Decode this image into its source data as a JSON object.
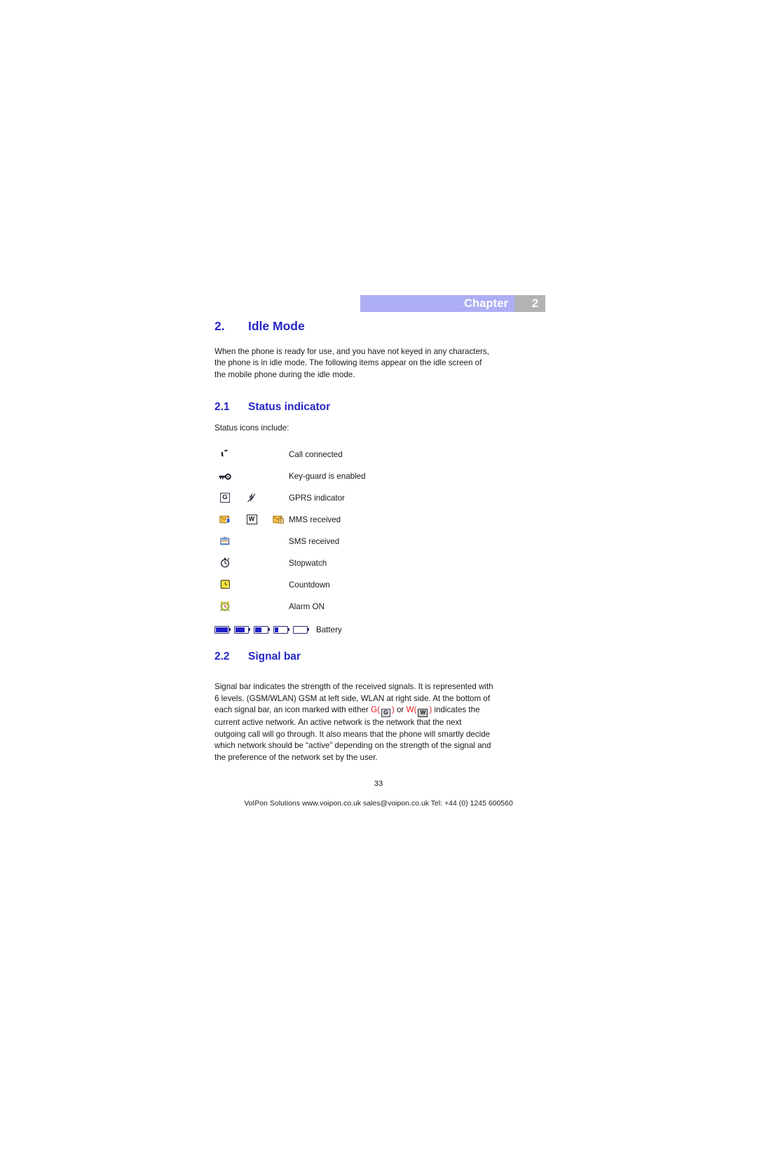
{
  "header": {
    "chapter_label": "Chapter",
    "chapter_number": "2",
    "bar_color": "#aeaef5",
    "number_block_color": "#b3b3b3"
  },
  "section": {
    "number": "2.",
    "title": "Idle Mode",
    "heading_color": "#2626c8",
    "intro": "When the phone is ready for use, and you have not keyed in any characters, the phone is in idle mode. The following items appear on the idle screen of the mobile phone during the idle mode."
  },
  "status_indicator": {
    "number": "2.1",
    "title": "Status indicator",
    "lead_in": "Status icons include:",
    "rows": [
      {
        "icons": [
          "phone-handset-icon"
        ],
        "label": "Call connected"
      },
      {
        "icons": [
          "key-icon"
        ],
        "label": "Key-guard is enabled"
      },
      {
        "icons": [
          "gprs-g-box-icon",
          "gprs-bolt-icon"
        ],
        "label": "GPRS indicator"
      },
      {
        "icons": [
          "mms-envelope-arrow-icon",
          "mms-w-box-icon",
          "mms-envelope-e-icon"
        ],
        "label": "MMS received"
      },
      {
        "icons": [
          "sms-envelope-icon"
        ],
        "label": "SMS received"
      },
      {
        "icons": [
          "stopwatch-icon"
        ],
        "label": "Stopwatch"
      },
      {
        "icons": [
          "countdown-icon"
        ],
        "label": "Countdown"
      },
      {
        "icons": [
          "alarm-clock-icon"
        ],
        "label": "Alarm ON"
      }
    ],
    "battery": {
      "label": "Battery",
      "levels": [
        100,
        72,
        48,
        26,
        0
      ],
      "fill_color": "#1f1fc8",
      "outline_color": "#2b2b6e"
    }
  },
  "signal_bar": {
    "number": "2.2",
    "title": "Signal bar",
    "text_part_1": "Signal bar indicates the strength of the received signals. It is represented with 6 levels. (GSM/WLAN) GSM at left side, WLAN at right side. At the bottom of each signal bar, an icon marked with either ",
    "marker_g": "G",
    "paren_open_1": "(",
    "paren_close_1": ")",
    "conjunction": " or ",
    "marker_w": "W",
    "paren_open_2": "(",
    "paren_close_2": ")",
    "text_part_2": " indicates the current active network. An active network is the network that the next outgoing call will go through. It also means that the phone will smartly decide which network should be “active” depending on the strength of the signal and the preference of the network set by the user.",
    "inline_g_icon_label": "G",
    "inline_w_icon_label": "W",
    "marker_color": "#e51919"
  },
  "page_number": "33",
  "footer": "VoIPon Solutions  www.voipon.co.uk  sales@voipon.co.uk  Tel: +44 (0) 1245 600560"
}
